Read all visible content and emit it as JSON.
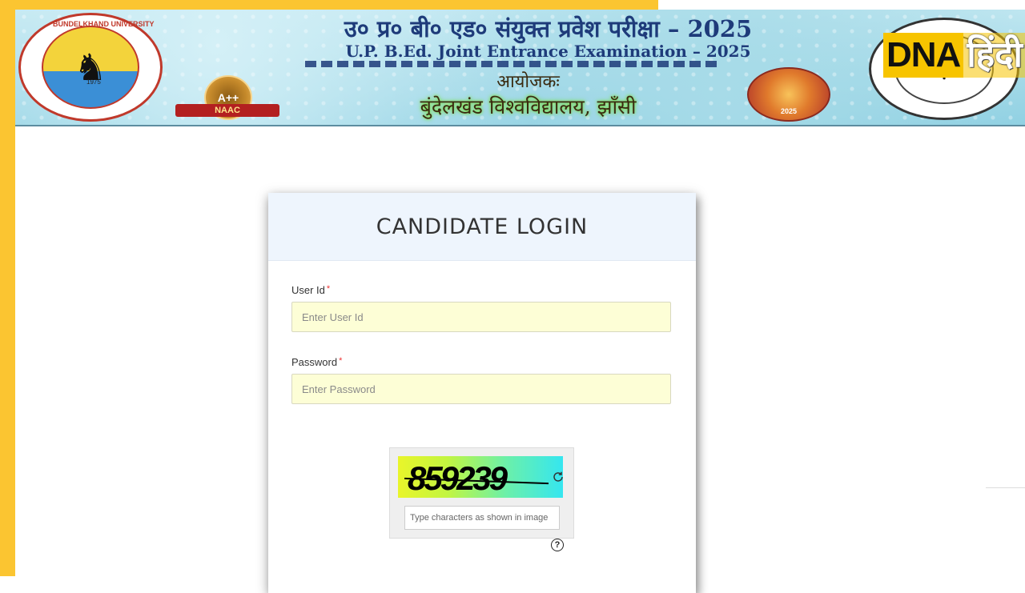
{
  "banner": {
    "title_hindi": "उ० प्र० बी० एड० संयुक्त प्रवेश परीक्षा – 2025",
    "title_english": "U.P. B.Ed. Joint Entrance Examination – 2025",
    "organizer_label": "आयोजकः",
    "organizer_name": "बुंदेलखंड विश्वविद्यालय, झाँसी",
    "naac_grade": "A++",
    "naac_label": "NAAC",
    "seal_year": "1975",
    "seal_text": "BUNDELKHAND UNIVERSITY",
    "event_year": "2025"
  },
  "watermark": {
    "dna": "DNA",
    "hindi": "हिंदी"
  },
  "login": {
    "title": "CANDIDATE LOGIN",
    "user_id_label": "User Id",
    "user_id_placeholder": "Enter User Id",
    "password_label": "Password",
    "password_placeholder": "Enter Password",
    "required_mark": "*",
    "captcha_text": "859239",
    "captcha_placeholder": "Type characters as shown in image",
    "help_symbol": "?"
  },
  "colors": {
    "frame": "#fbc531",
    "banner_title": "#1e3b7a",
    "input_bg": "#fdfed6",
    "card_header_bg": "#eef5fd"
  }
}
